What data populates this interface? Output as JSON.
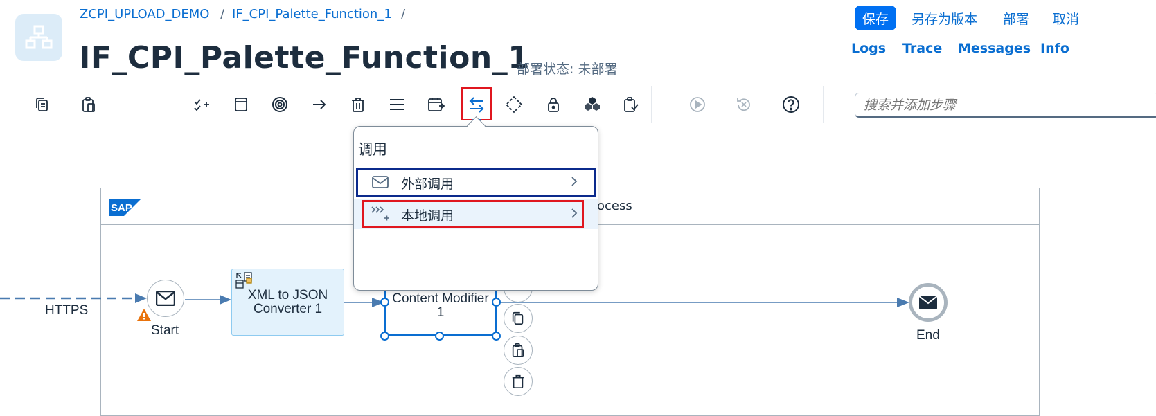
{
  "header": {
    "breadcrumb": [
      "ZCPI_UPLOAD_DEMO",
      "IF_CPI_Palette_Function_1"
    ],
    "breadcrumb_separator": "/",
    "title": "IF_CPI_Palette_Function_1",
    "deploy_status": "部署状态: 未部署",
    "actions": {
      "save": "保存",
      "save_as_version": "另存为版本",
      "deploy": "部署",
      "cancel": "取消"
    },
    "links": {
      "logs": "Logs",
      "trace": "Trace",
      "messages": "Messages",
      "info": "Info"
    }
  },
  "toolbar": {
    "icons": [
      "copy-icon",
      "paste-icon",
      "participant-add-icon",
      "process-icon",
      "event-icon",
      "connection-icon",
      "delete-icon",
      "menu-icon",
      "schedule-icon",
      "call-icon",
      "gateway-icon",
      "security-icon",
      "persistence-icon",
      "validator-icon",
      "simulate-icon",
      "reset-icon",
      "help-icon"
    ],
    "search_placeholder": "搜索并添加步骤"
  },
  "popover": {
    "title": "调用",
    "items": [
      {
        "label": "外部调用",
        "icon": "envelope-icon"
      },
      {
        "label": "本地调用",
        "icon": "local-call-icon"
      }
    ]
  },
  "canvas": {
    "pool_label_partial": "ocess",
    "sender_channel": "HTTPS",
    "start_event": "Start",
    "xml_converter": [
      "XML to JSON",
      "Converter 1"
    ],
    "content_modifier": [
      "Content Modifier",
      "1"
    ],
    "end_event": "End"
  },
  "colors": {
    "accent": "#0a6ed1",
    "save_button": "#0070f2",
    "highlight_red": "#e0161f",
    "highlight_navy": "#0b2a8c",
    "warning": "#e9730c"
  }
}
